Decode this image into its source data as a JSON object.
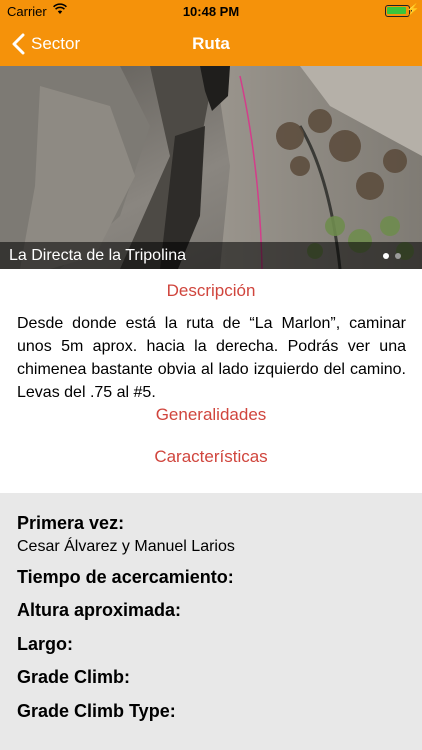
{
  "status_bar": {
    "carrier": "Carrier",
    "time": "10:48 PM",
    "battery_icon": "battery-charging-icon",
    "wifi_icon": "wifi-icon"
  },
  "nav": {
    "back_label": "Sector",
    "title": "Ruta",
    "bar_color": "#f5920a"
  },
  "gallery": {
    "caption": "La Directa de la Tripolina",
    "page_count": 2,
    "current_page": 1
  },
  "sections": {
    "description_title": "Descripción",
    "description_text": "Desde donde está la ruta de “La Marlon”, caminar unos 5m aprox. hacia la derecha. Podrás ver una chimenea bastante obvia al lado izquierdo del camino. Levas del .75 al #5.",
    "general_title": "Generalidades",
    "features_title": "Características",
    "link_color": "#d0453d"
  },
  "details": {
    "first_ascent_label": "Primera vez:",
    "first_ascent_value": "Cesar Álvarez y Manuel Larios",
    "approach_time_label": "Tiempo de acercamiento:",
    "height_label": "Altura aproximada:",
    "length_label": "Largo:",
    "grade_label": "Grade Climb:",
    "grade_type_label": "Grade Climb Type:"
  }
}
